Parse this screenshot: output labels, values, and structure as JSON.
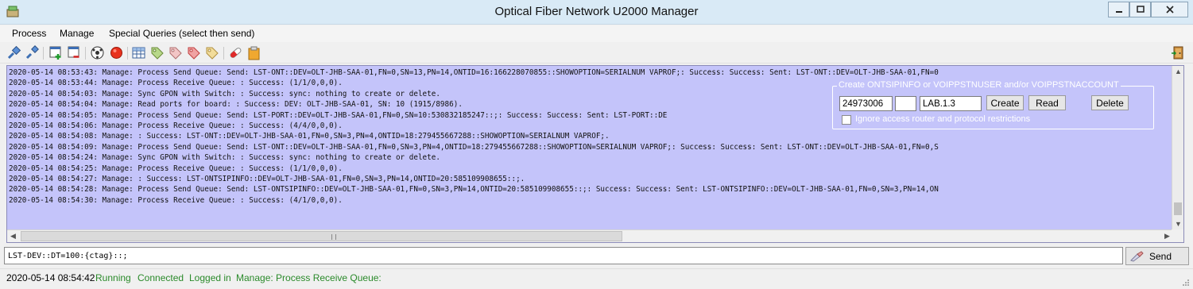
{
  "window": {
    "title": "Optical Fiber Network U2000 Manager"
  },
  "menu": {
    "items": [
      {
        "label": "Process"
      },
      {
        "label": "Manage"
      },
      {
        "label": "Special Queries (select then send)"
      }
    ]
  },
  "toolbar": {
    "icons": [
      "connect-plug-icon",
      "disconnect-plug-icon",
      "add-window-icon",
      "remove-window-icon",
      "ball-icon",
      "stop-red-icon",
      "table-grid-icon",
      "tag-green-icon",
      "tag-pink-icon",
      "tag-red-icon",
      "tag-yellow-icon",
      "pill-icon",
      "clipboard-icon",
      "exit-door-icon"
    ]
  },
  "log": {
    "lines": [
      "2020-05-14 08:53:43: Manage: Process Send Queue: Send: LST-ONT::DEV=OLT-JHB-SAA-01,FN=0,SN=13,PN=14,ONTID=16:166228070855::SHOWOPTION=SERIALNUM VAPROF;: Success: Success: Sent: LST-ONT::DEV=OLT-JHB-SAA-01,FN=0",
      "2020-05-14 08:53:44: Manage: Process Receive Queue: : Success: (1/1/0,0,0).",
      "2020-05-14 08:54:03: Manage: Sync GPON with Switch: : Success: sync: nothing to create or delete.",
      "2020-05-14 08:54:04: Manage: Read ports for board: : Success: DEV: OLT-JHB-SAA-01, SN: 10 (1915/8986).",
      "2020-05-14 08:54:05: Manage: Process Send Queue: Send: LST-PORT::DEV=OLT-JHB-SAA-01,FN=0,SN=10:530832185247::;: Success: Success: Sent: LST-PORT::DE",
      "2020-05-14 08:54:06: Manage: Process Receive Queue: : Success: (4/4/0,0,0).",
      "2020-05-14 08:54:08: Manage: : Success: LST-ONT::DEV=OLT-JHB-SAA-01,FN=0,SN=3,PN=4,ONTID=18:279455667288::SHOWOPTION=SERIALNUM VAPROF;.",
      "2020-05-14 08:54:09: Manage: Process Send Queue: Send: LST-ONT::DEV=OLT-JHB-SAA-01,FN=0,SN=3,PN=4,ONTID=18:279455667288::SHOWOPTION=SERIALNUM VAPROF;: Success: Success: Sent: LST-ONT::DEV=OLT-JHB-SAA-01,FN=0,S",
      "2020-05-14 08:54:24: Manage: Sync GPON with Switch: : Success: sync: nothing to create or delete.",
      "2020-05-14 08:54:25: Manage: Process Receive Queue: : Success: (1/1/0,0,0).",
      "2020-05-14 08:54:27: Manage: : Success: LST-ONTSIPINFO::DEV=OLT-JHB-SAA-01,FN=0,SN=3,PN=14,ONTID=20:585109908655::;.",
      "2020-05-14 08:54:28: Manage: Process Send Queue: Send: LST-ONTSIPINFO::DEV=OLT-JHB-SAA-01,FN=0,SN=3,PN=14,ONTID=20:585109908655::;: Success: Success: Sent: LST-ONTSIPINFO::DEV=OLT-JHB-SAA-01,FN=0,SN=3,PN=14,ON",
      "2020-05-14 08:54:30: Manage: Process Receive Queue: : Success: (4/1/0,0,0)."
    ]
  },
  "create_panel": {
    "legend": "Create ONTSIPINFO or VOIPPSTNUSER and/or VOIPPSTNACCOUNT",
    "field1_value": "24973006",
    "field2_value": "",
    "field3_value": "LAB.1.3",
    "create_label": "Create",
    "read_label": "Read",
    "delete_label": "Delete",
    "checkbox_label": "Ignore access router and protocol restrictions"
  },
  "command": {
    "value": "LST-DEV::DT=100:{ctag}::;",
    "send_label": "Send"
  },
  "status": {
    "timestamp": "2020-05-14 08:54:42",
    "running": "Running",
    "connected": "Connected",
    "logged_in": "Logged in",
    "message": "Manage: Process Receive Queue:"
  },
  "colors": {
    "log_background": "#c4c4fa",
    "status_green": "#2a8a2a",
    "titlebar": "#d9eaf6"
  }
}
